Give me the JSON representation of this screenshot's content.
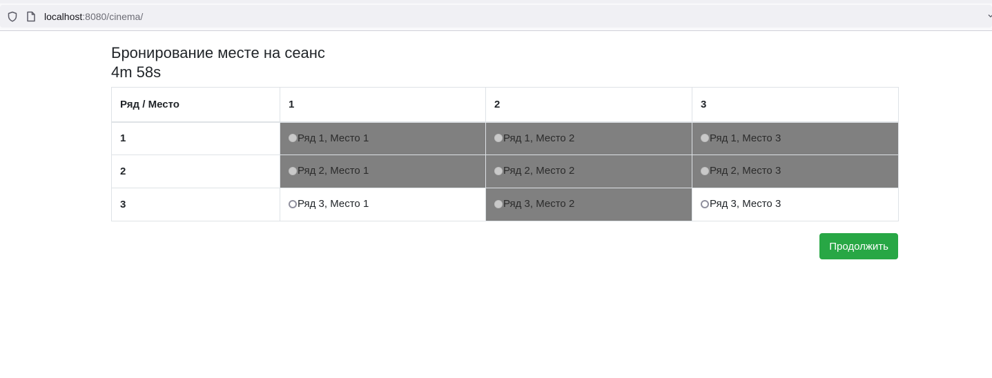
{
  "browser": {
    "url_host": "localhost",
    "url_rest": ":8080/cinema/"
  },
  "page": {
    "title": "Бронирование месте на сеанс",
    "timer": "4m 58s"
  },
  "table": {
    "corner_header": "Ряд / Место",
    "columns": [
      "1",
      "2",
      "3"
    ],
    "rows": [
      {
        "label": "1",
        "seats": [
          {
            "text": "Ряд 1, Место 1",
            "status": "taken"
          },
          {
            "text": "Ряд 1, Место 2",
            "status": "taken"
          },
          {
            "text": "Ряд 1, Место 3",
            "status": "taken"
          }
        ]
      },
      {
        "label": "2",
        "seats": [
          {
            "text": "Ряд 2, Место 1",
            "status": "taken"
          },
          {
            "text": "Ряд 2, Место 2",
            "status": "taken"
          },
          {
            "text": "Ряд 2, Место 3",
            "status": "taken"
          }
        ]
      },
      {
        "label": "3",
        "seats": [
          {
            "text": "Ряд 3, Место 1",
            "status": "free"
          },
          {
            "text": "Ряд 3, Место 2",
            "status": "taken"
          },
          {
            "text": "Ряд 3, Место 3",
            "status": "free"
          }
        ]
      }
    ]
  },
  "actions": {
    "continue_label": "Продолжить"
  },
  "colors": {
    "taken_cell": "#808080",
    "continue_button": "#28a745"
  }
}
